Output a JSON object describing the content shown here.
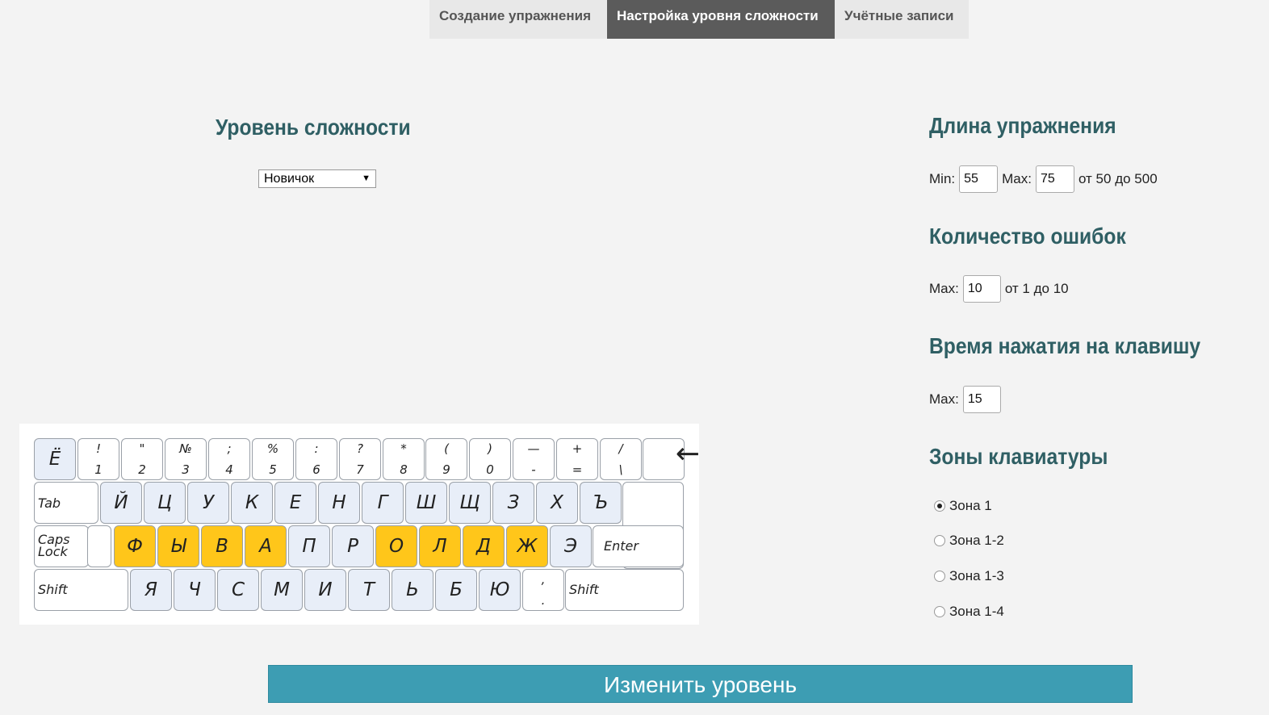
{
  "tabs": [
    {
      "label": "Создание упражнения",
      "active": false
    },
    {
      "label": "Настройка уровня сложности",
      "active": true
    },
    {
      "label": "Учётные записи",
      "active": false
    }
  ],
  "difficulty": {
    "title": "Уровень сложности",
    "selected": "Новичок",
    "arrow": "▼"
  },
  "keyboard": {
    "row0": [
      {
        "main": "Ё"
      },
      {
        "top": "!",
        "bottom": "1"
      },
      {
        "top": "\"",
        "bottom": "2"
      },
      {
        "top": "№",
        "bottom": "3"
      },
      {
        "top": ";",
        "bottom": "4"
      },
      {
        "top": "%",
        "bottom": "5"
      },
      {
        "top": ":",
        "bottom": "6"
      },
      {
        "top": "?",
        "bottom": "7"
      },
      {
        "top": "*",
        "bottom": "8"
      },
      {
        "top": "(",
        "bottom": "9"
      },
      {
        "top": ")",
        "bottom": "0"
      },
      {
        "top": "—",
        "bottom": "-"
      },
      {
        "top": "+",
        "bottom": "="
      },
      {
        "top": "/",
        "bottom": "\\"
      },
      {
        "main": "←"
      }
    ],
    "row1": [
      "Tab",
      "Й",
      "Ц",
      "У",
      "К",
      "Е",
      "Н",
      "Г",
      "Ш",
      "Щ",
      "З",
      "Х",
      "Ъ"
    ],
    "row2": [
      "Caps Lock",
      "Ф",
      "Ы",
      "В",
      "А",
      "П",
      "Р",
      "О",
      "Л",
      "Д",
      "Ж",
      "Э",
      "Enter"
    ],
    "row3": [
      "Shift",
      "Я",
      "Ч",
      "С",
      "М",
      "И",
      "Т",
      "Ь",
      "Б",
      "Ю",
      ",",
      ".",
      "Shift"
    ],
    "highlight_color": "#ffc61a"
  },
  "length": {
    "title": "Длина упражнения",
    "min_label": "Min:",
    "min_value": "55",
    "max_label": "Max:",
    "max_value": "75",
    "range_text": "от 50 до 500"
  },
  "errors": {
    "title": "Количество ошибок",
    "max_label": "Max:",
    "max_value": "10",
    "range_text": "от 1 до 10"
  },
  "keytime": {
    "title": "Время нажатия на клавишу",
    "max_label": "Max:",
    "max_value": "15"
  },
  "zones": {
    "title": "Зоны клавиатуры",
    "options": [
      {
        "label": "Зона 1",
        "checked": true
      },
      {
        "label": "Зона 1-2",
        "checked": false
      },
      {
        "label": "Зона 1-3",
        "checked": false
      },
      {
        "label": "Зона 1-4",
        "checked": false
      }
    ]
  },
  "submit_label": "Изменить уровень",
  "colors": {
    "heading": "#2f5f64",
    "active_tab": "#5b5b5b",
    "button": "#3d9db3"
  }
}
